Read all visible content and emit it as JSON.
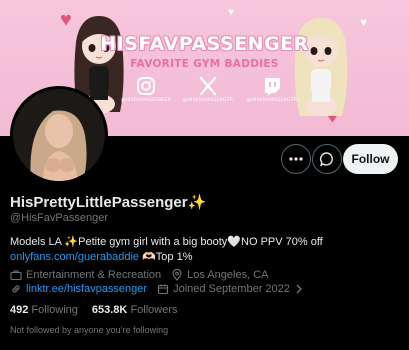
{
  "banner": {
    "title": "HISFAVPASSENGER",
    "subtitle": "FAVORITE GYM BADDIES",
    "instagram_handle": "@HISFAVPASSENGER",
    "x_handle": "@HISFAVPASSENGER",
    "twitch_handle": "@HISFAVPASSENGER"
  },
  "actions": {
    "follow_label": "Follow"
  },
  "profile": {
    "display_name": "HisPrettyLittlePassenger",
    "name_emoji": "✨",
    "handle": "@HisFavPassenger",
    "bio_text_1": "Models LA ",
    "bio_sparkle": "✨",
    "bio_text_2": "Petite gym girl with a big booty",
    "bio_heart": "🤍",
    "bio_text_3": "NO PPV 70% off ",
    "bio_link": "onlyfans.com/guerabaddie",
    "bio_text_4": " ",
    "bio_handshake": "🫶🏻",
    "bio_text_5": "Top 1%",
    "category": "Entertainment & Recreation",
    "location": "Los Angeles, CA",
    "website": "linktr.ee/hisfavpassenger",
    "joined": "Joined September 2022"
  },
  "stats": {
    "following_count": "492",
    "following_label": "Following",
    "followers_count": "653.8K",
    "followers_label": "Followers"
  },
  "not_followed_text": "Not followed by anyone you’re following",
  "colors": {
    "banner_pink": "#f3bad3",
    "accent_blue": "#1d9bf0",
    "muted": "#71767b",
    "heart_red": "#e0567f"
  }
}
